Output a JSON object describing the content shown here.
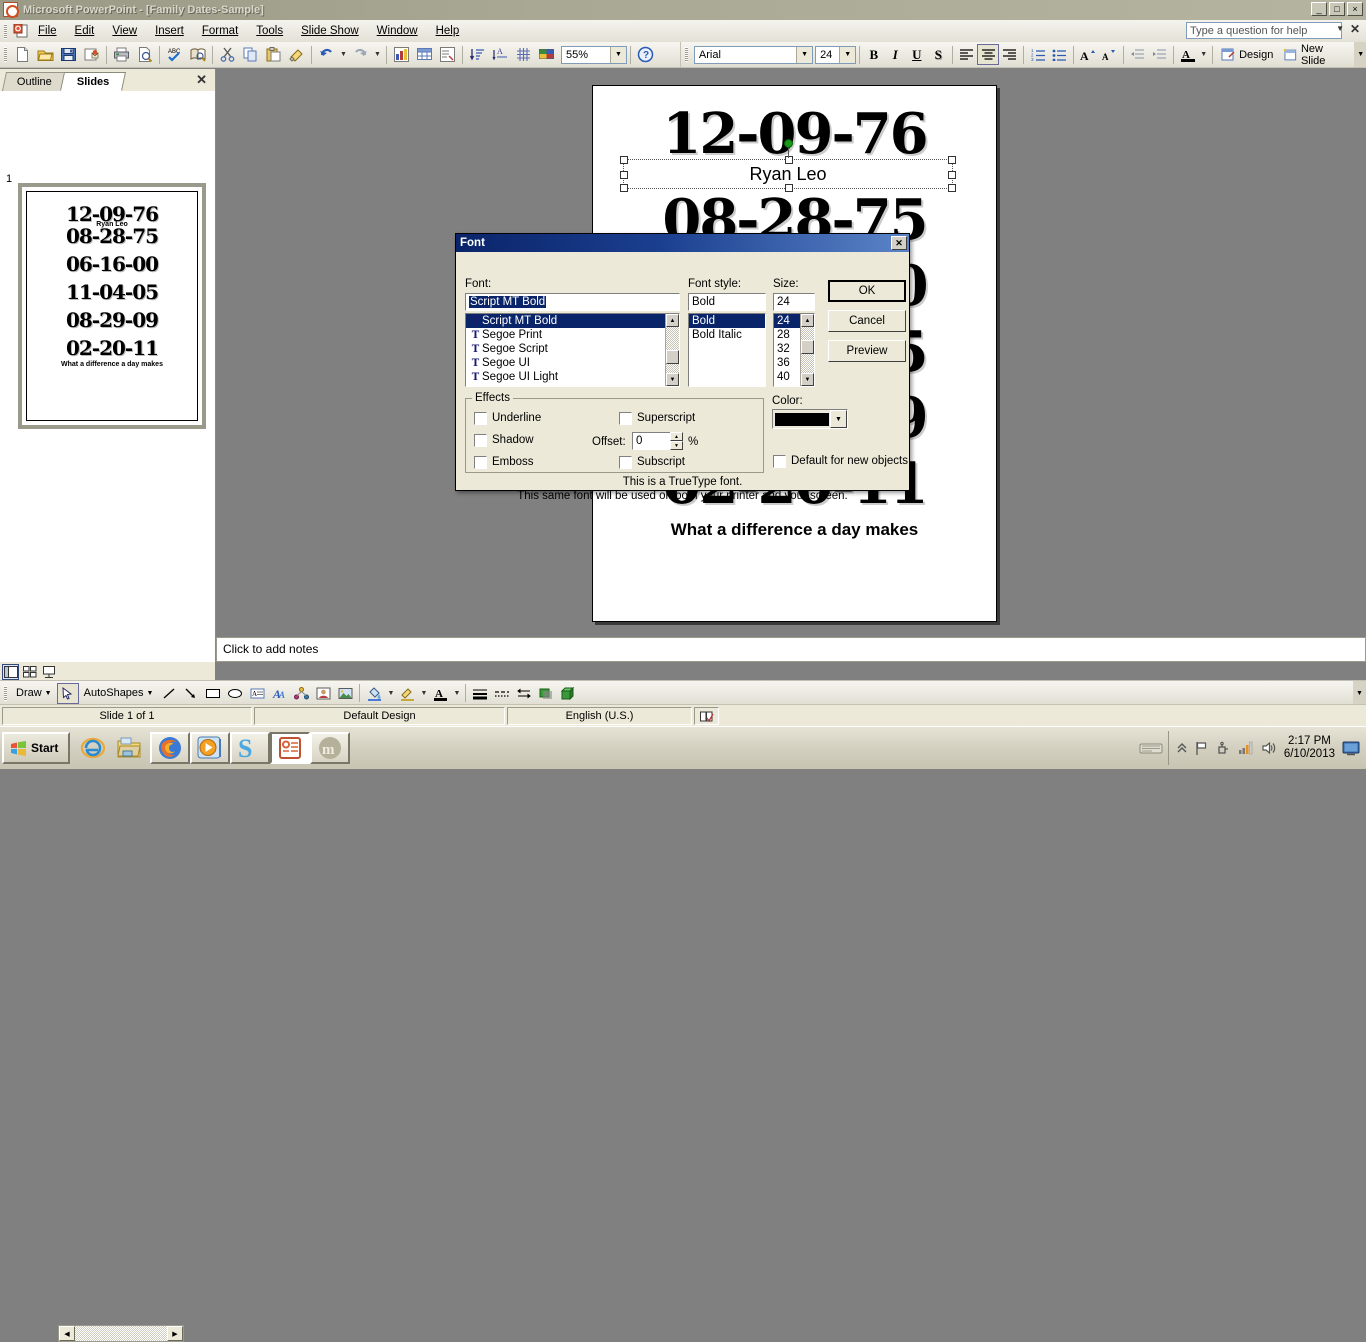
{
  "window": {
    "title": "Microsoft PowerPoint - [Family Dates-Sample]",
    "app_icon": "powerpoint-icon",
    "minimize": "_",
    "maximize": "□",
    "close": "×"
  },
  "menubar": {
    "items": [
      {
        "label": "File",
        "accel": "F"
      },
      {
        "label": "Edit",
        "accel": "E"
      },
      {
        "label": "View",
        "accel": "V"
      },
      {
        "label": "Insert",
        "accel": "I"
      },
      {
        "label": "Format",
        "accel": "o"
      },
      {
        "label": "Tools",
        "accel": "T"
      },
      {
        "label": "Slide Show",
        "accel": "S"
      },
      {
        "label": "Window",
        "accel": "W"
      },
      {
        "label": "Help",
        "accel": "H"
      }
    ],
    "help_box": {
      "placeholder": "Type a question for help",
      "value": "Type a question for help"
    }
  },
  "toolbar_standard": {
    "buttons": [
      "new-icon",
      "open-icon",
      "save-icon",
      "email-icon",
      "print-icon",
      "print-preview-icon",
      "spelling-icon",
      "research-icon",
      "cut-icon",
      "copy-icon",
      "paste-icon",
      "format-painter-icon",
      "undo-icon",
      "redo-icon",
      "insert-chart-icon",
      "insert-table-icon",
      "insert-diagram-icon",
      "sort-icon",
      "expand-all-icon",
      "show-grid-icon",
      "color-scheme-icon"
    ],
    "zoom": {
      "label": "55%",
      "value": "55%"
    },
    "help_button": "help-icon"
  },
  "toolbar_formatting": {
    "font": {
      "value": "Arial"
    },
    "size": {
      "value": "24"
    },
    "bold": "B",
    "italic": "I",
    "underline": "U",
    "shadow": "S",
    "align_left": "align-left-icon",
    "align_center": "align-center-icon",
    "align_right": "align-right-icon",
    "numbered_list": "numbered-list-icon",
    "bulleted_list": "bulleted-list-icon",
    "increase_font": "A",
    "decrease_font": "A",
    "decrease_indent": "decrease-indent-icon",
    "increase_indent": "increase-indent-icon",
    "font_color": "A",
    "design_label": "Design",
    "new_slide_label": "New Slide"
  },
  "left_pane": {
    "tabs": [
      {
        "label": "Outline",
        "active": false
      },
      {
        "label": "Slides",
        "active": true
      }
    ],
    "close_label": "✕",
    "slide_number": "1"
  },
  "slide": {
    "dates": [
      "12-09-76",
      "08-28-75",
      "06-16-00",
      "11-04-05",
      "08-29-09",
      "02-20-11"
    ],
    "selected_textbox": {
      "text": "Ryan Leo",
      "selected": true
    },
    "footer": "What a difference a day makes"
  },
  "notes": {
    "placeholder": "Click to add notes",
    "text": "Click to add notes"
  },
  "view_buttons": [
    {
      "name": "normal-view",
      "active": true
    },
    {
      "name": "slide-sorter-view",
      "active": false
    },
    {
      "name": "slide-show-view",
      "active": false
    }
  ],
  "drawing_toolbar": {
    "draw_label": "Draw",
    "select_label": "select-objects-icon",
    "autoshapes_label": "AutoShapes",
    "tools": [
      "line-icon",
      "arrow-icon",
      "rectangle-icon",
      "oval-icon",
      "text-box-icon",
      "wordart-icon",
      "diagram-icon",
      "clip-art-icon",
      "picture-icon",
      "fill-color-icon",
      "line-color-icon",
      "font-color-icon",
      "line-style-icon",
      "dash-style-icon",
      "arrow-style-icon",
      "shadow-style-icon",
      "3d-style-icon"
    ]
  },
  "statusbar": {
    "slide_info": "Slide 1 of 1",
    "design": "Default Design",
    "language": "English (U.S.)",
    "spell_icon": "spell-check-icon"
  },
  "taskbar": {
    "start_label": "Start",
    "quick_launch": [
      "internet-explorer-icon",
      "file-explorer-icon"
    ],
    "apps": [
      {
        "name": "firefox-icon",
        "active": false
      },
      {
        "name": "media-player-icon",
        "active": false
      },
      {
        "name": "skype-icon",
        "active": false
      },
      {
        "name": "powerpoint-icon",
        "active": true
      },
      {
        "name": "moodle-icon",
        "active": false
      }
    ],
    "tray": [
      "keyboard-icon",
      "show-hidden-icon",
      "flag-icon",
      "usb-icon",
      "network-icon",
      "volume-icon"
    ],
    "clock": {
      "time": "2:17 PM",
      "date": "6/10/2013"
    },
    "show_desktop": "show-desktop-icon"
  },
  "font_dialog": {
    "title": "Font",
    "close_label": "✕",
    "labels": {
      "font": "Font:",
      "font_style": "Font style:",
      "size": "Size:",
      "color": "Color:",
      "effects": "Effects",
      "offset": "Offset:",
      "percent": "%"
    },
    "font_input": {
      "value": "Script MT Bold"
    },
    "font_list": [
      {
        "label": "Script MT Bold",
        "selected": true
      },
      {
        "label": "Segoe Print",
        "selected": false
      },
      {
        "label": "Segoe Script",
        "selected": false
      },
      {
        "label": "Segoe UI",
        "selected": false
      },
      {
        "label": "Segoe UI Light",
        "selected": false
      }
    ],
    "style_input": {
      "value": "Bold"
    },
    "style_list": [
      {
        "label": "Bold",
        "selected": true
      },
      {
        "label": "Bold Italic",
        "selected": false
      }
    ],
    "size_input": {
      "value": "24"
    },
    "size_list": [
      {
        "label": "24",
        "selected": true
      },
      {
        "label": "28",
        "selected": false
      },
      {
        "label": "32",
        "selected": false
      },
      {
        "label": "36",
        "selected": false
      },
      {
        "label": "40",
        "selected": false
      }
    ],
    "buttons": {
      "ok": "OK",
      "cancel": "Cancel",
      "preview": "Preview"
    },
    "effects": [
      {
        "label": "Underline",
        "checked": false
      },
      {
        "label": "Shadow",
        "checked": false
      },
      {
        "label": "Emboss",
        "checked": false
      },
      {
        "label": "Superscript",
        "checked": false
      },
      {
        "label": "Subscript",
        "checked": false
      }
    ],
    "offset": {
      "value": "0"
    },
    "color": {
      "value": "#000000"
    },
    "default_checkbox": {
      "label": "Default for new objects",
      "checked": false
    },
    "note_line1": "This is a TrueType font.",
    "note_line2": "This same font will be used on both your printer and your screen."
  }
}
